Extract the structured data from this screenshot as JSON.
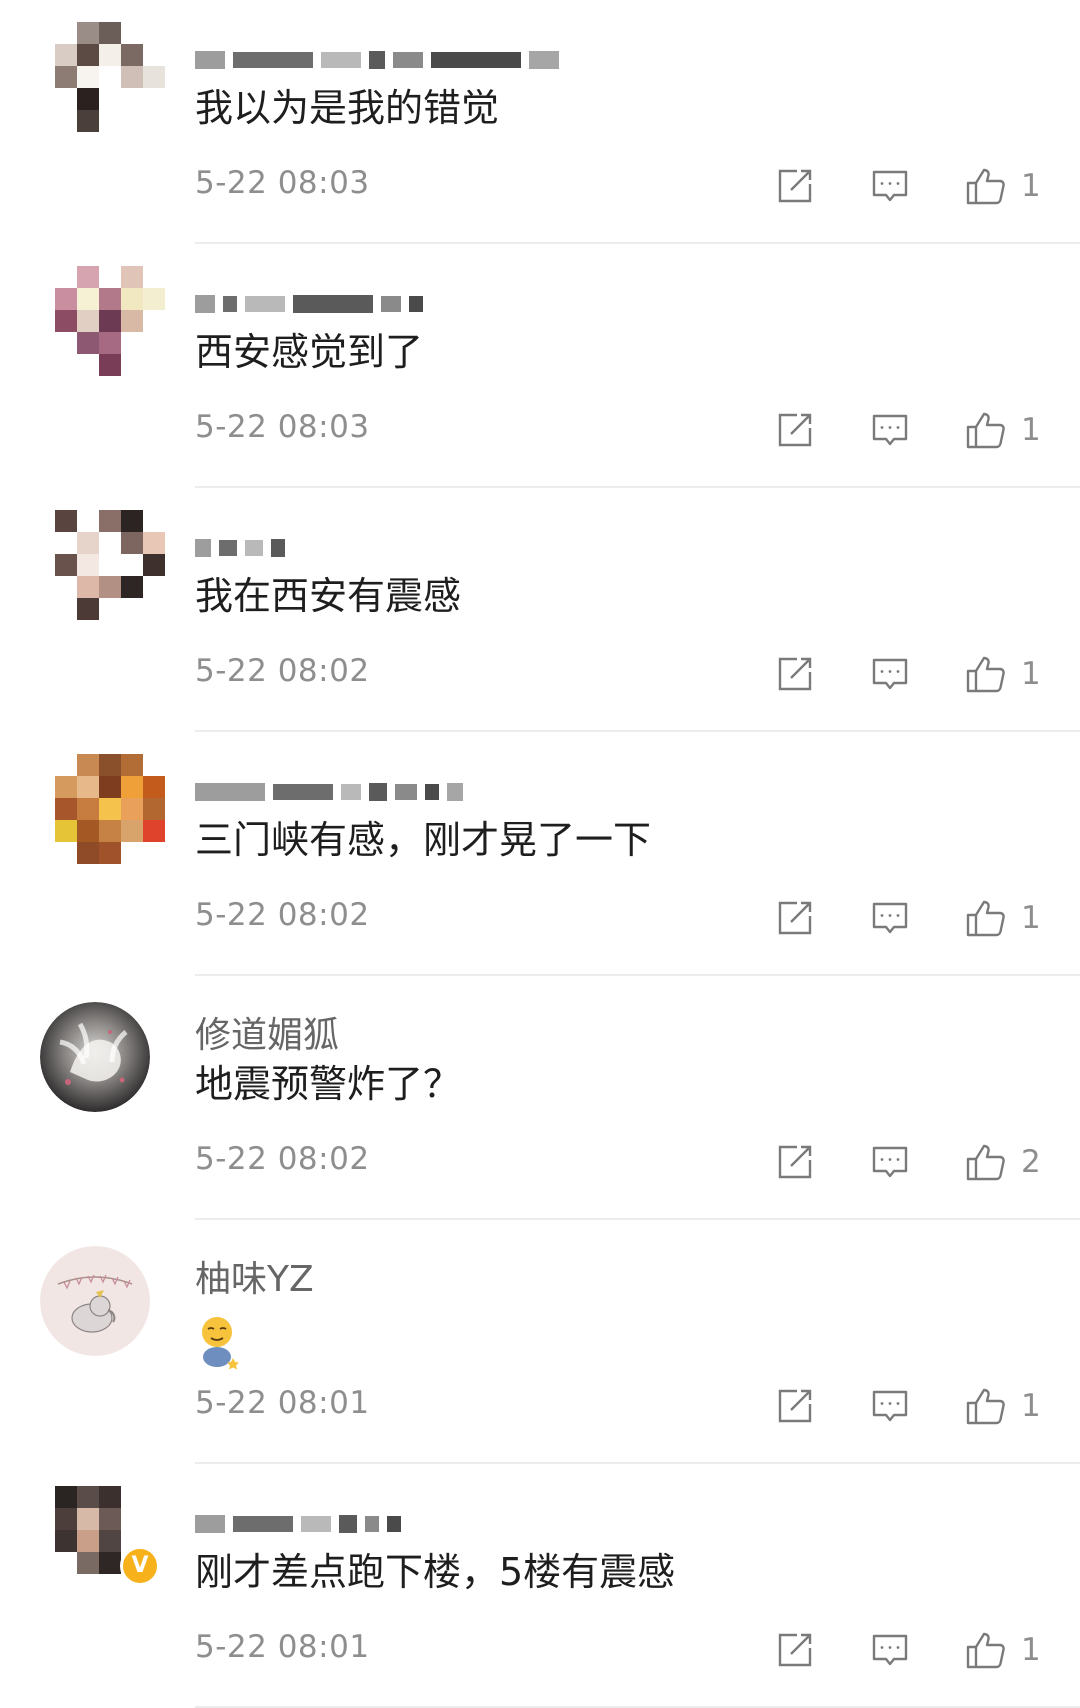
{
  "comments": [
    {
      "username": "",
      "username_hidden": true,
      "text": "我以为是我的错觉",
      "time": "5-22 08:03",
      "likes": "1",
      "avatar_colors": [
        "#ffffff",
        "#9a8c86",
        "#6b5e58",
        "#ffffff",
        "#ffffff",
        "#d9ccc5",
        "#5c4b45",
        "#f4efe9",
        "#7a6a63",
        "#ffffff",
        "#8d7c74",
        "#f7f3ef",
        "#ffffff",
        "#cfbfb7",
        "#e8e2dc",
        "#ffffff",
        "#2b2220",
        "#ffffff",
        "#ffffff",
        "#ffffff",
        "#ffffff",
        "#4a3f3a",
        "#ffffff",
        "#ffffff",
        "#ffffff"
      ]
    },
    {
      "username": "",
      "username_hidden": true,
      "text": "西安感觉到了",
      "time": "5-22 08:03",
      "likes": "1",
      "avatar_colors": [
        "#ffffff",
        "#d5a4b0",
        "#ffffff",
        "#e0c4b8",
        "#ffffff",
        "#c98fa0",
        "#f6f0d4",
        "#b2798b",
        "#f1e7c0",
        "#f3eecf",
        "#8c4c63",
        "#e2cfc4",
        "#6c3a52",
        "#d7b9a6",
        "#ffffff",
        "#ffffff",
        "#8d5872",
        "#a66b83",
        "#ffffff",
        "#ffffff",
        "#ffffff",
        "#ffffff",
        "#7a3d58",
        "#ffffff",
        "#ffffff"
      ]
    },
    {
      "username": "",
      "username_hidden": true,
      "text": "我在西安有震感",
      "time": "5-22 08:02",
      "likes": "1",
      "avatar_colors": [
        "#5a4440",
        "#ffffff",
        "#8a6f69",
        "#2c2422",
        "#ffffff",
        "#ffffff",
        "#e6d3ca",
        "#ffffff",
        "#7e6660",
        "#e9c7b7",
        "#6a524c",
        "#f4e8e2",
        "#ffffff",
        "#ffffff",
        "#3e302d",
        "#ffffff",
        "#ddb7a7",
        "#b39084",
        "#2e2624",
        "#ffffff",
        "#ffffff",
        "#4b3a36",
        "#ffffff",
        "#ffffff",
        "#ffffff"
      ]
    },
    {
      "username": "",
      "username_hidden": true,
      "text": "三门峡有感，刚才晃了一下",
      "time": "5-22 08:02",
      "likes": "1",
      "avatar_colors": [
        "#ffffff",
        "#c88a52",
        "#8a4f2b",
        "#b26d36",
        "#ffffff",
        "#d49a5e",
        "#e7b98a",
        "#7f3d1f",
        "#f0a038",
        "#c25b1c",
        "#a7552a",
        "#c77c40",
        "#f5c24b",
        "#e8a05a",
        "#b26730",
        "#e6c437",
        "#a45824",
        "#c58244",
        "#d9a36c",
        "#e0432c",
        "#ffffff",
        "#8f4a28",
        "#a0522b",
        "#ffffff",
        "#ffffff"
      ]
    },
    {
      "username": "修道媚狐",
      "username_hidden": false,
      "text": "地震预警炸了？",
      "time": "5-22 08:02",
      "likes": "2"
    },
    {
      "username": "柚味YZ",
      "username_hidden": false,
      "text": "",
      "time": "5-22 08:01",
      "likes": "1",
      "emoji": "relieved-face-sitting-emoji"
    },
    {
      "username": "",
      "username_hidden": true,
      "text": "刚才差点跑下楼，5楼有震感",
      "time": "5-22 08:01",
      "likes": "1",
      "verified": "V",
      "avatar_colors": [
        "#2a2422",
        "#5a4d49",
        "#3b302d",
        "#ffffff",
        "#ffffff",
        "#4c3f3b",
        "#d7b9a7",
        "#6b5a55",
        "#ffffff",
        "#ffffff",
        "#3d3431",
        "#c99f8a",
        "#504542",
        "#ffffff",
        "#ffffff",
        "#ffffff",
        "#7a6a64",
        "#2e2725",
        "#ffffff",
        "#ffffff",
        "#ffffff",
        "#ffffff",
        "#ffffff",
        "#ffffff",
        "#ffffff"
      ]
    }
  ],
  "icons": {
    "share": "share-icon",
    "reply": "comment-icon",
    "like": "thumbs-up-icon"
  },
  "colors": {
    "text": "#1e1e1e",
    "meta": "#8e8e8e",
    "divider": "#ececec",
    "verified": "#f6b11b"
  }
}
